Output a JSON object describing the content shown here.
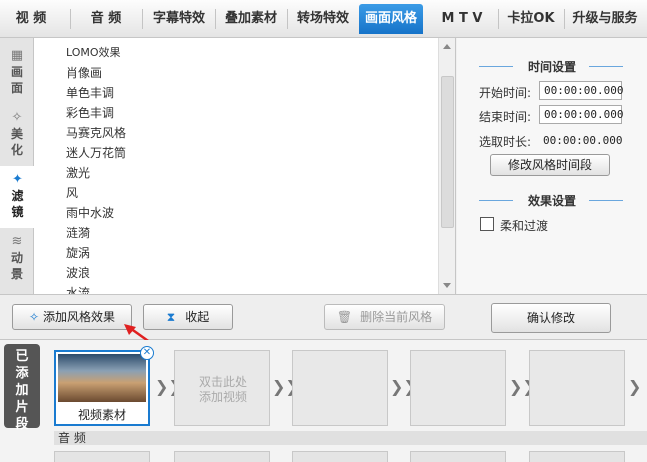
{
  "top_tabs": [
    {
      "label": "视 频"
    },
    {
      "label": "音 频"
    },
    {
      "label": "字幕特效"
    },
    {
      "label": "叠加素材"
    },
    {
      "label": "转场特效"
    },
    {
      "label": "画面风格",
      "active": true
    },
    {
      "label": "M T V"
    },
    {
      "label": "卡拉OK"
    },
    {
      "label": "升级与服务"
    }
  ],
  "side_nav": [
    {
      "label_line1": "画",
      "label_line2": "面",
      "icon": "picture-icon"
    },
    {
      "label_line1": "美",
      "label_line2": "化",
      "icon": "magic-wand-icon"
    },
    {
      "label_line1": "滤",
      "label_line2": "镜",
      "icon": "filter-wand-icon",
      "active": true
    },
    {
      "label_line1": "动",
      "label_line2": "景",
      "icon": "wave-icon"
    }
  ],
  "effects_list": [
    "LOMO效果",
    "肖像画",
    "单色丰调",
    "彩色丰调",
    "马赛克风格",
    "迷人万花筒",
    "激光",
    "风",
    "雨中水波",
    "涟漪",
    "旋涡",
    "波浪",
    "水流"
  ],
  "time_settings": {
    "title": "时间设置",
    "start_label": "开始时间:",
    "start_value": "00:00:00.000",
    "end_label": "结束时间:",
    "end_value": "00:00:00.000",
    "duration_label": "选取时长:",
    "duration_value": "00:00:00.000",
    "modify_button": "修改风格时间段"
  },
  "effect_settings": {
    "title": "效果设置",
    "soft_transition_label": "柔和过渡",
    "soft_transition_checked": false
  },
  "buttons": {
    "add_effect": "添加风格效果",
    "collapse": "收起",
    "delete_current": "删除当前风格",
    "confirm": "确认修改"
  },
  "timeline": {
    "label": "已添加片段",
    "clip_name": "视频素材",
    "placeholder_hint_line1": "双击此处",
    "placeholder_hint_line2": "添加视频",
    "audio_label": "音 频"
  },
  "colors": {
    "accent": "#1a7bd0",
    "annotation_arrow": "#e02020"
  }
}
